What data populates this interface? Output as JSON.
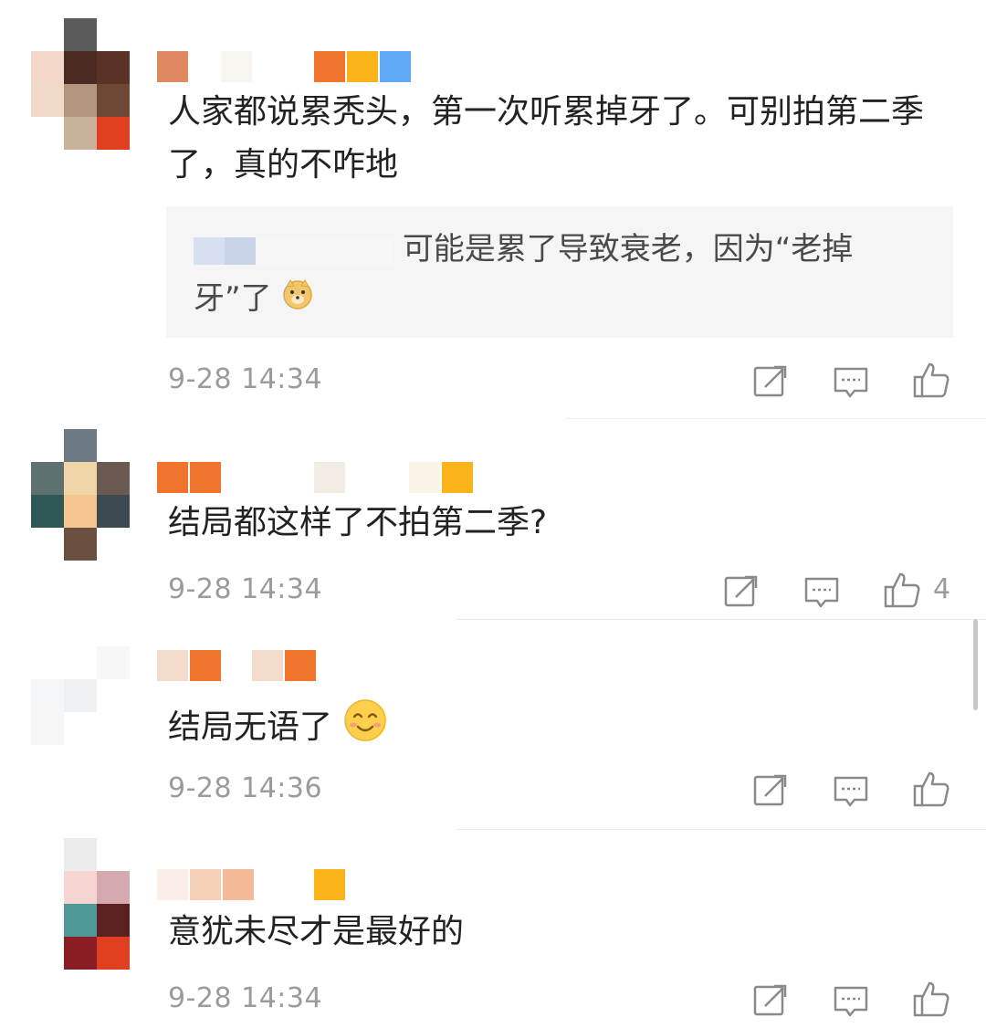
{
  "comments": [
    {
      "text": "人家都说累秃头，第一次听累掉牙了。可别拍第二季了，真的不咋地",
      "reply": {
        "text": "可能是累了导致衰老，因为“老掉牙”了",
        "emoji_icon": "doge-emoji-icon"
      },
      "time": "9-28 14:34",
      "like_count": ""
    },
    {
      "text": "结局都这样了不拍第二季?",
      "time": "9-28 14:34",
      "like_count": "4"
    },
    {
      "text": "结局无语了",
      "emoji_icon": "smile-emoji-icon",
      "time": "9-28 14:36",
      "like_count": ""
    },
    {
      "text": "意犹未尽才是最好的",
      "time": "9-28 14:34",
      "like_count": ""
    }
  ],
  "icons": {
    "repost": "repost-icon",
    "comment": "comment-icon",
    "like": "like-icon"
  },
  "colors": {
    "text": "#222222",
    "meta": "#9b9b9b",
    "quote_bg": "#f5f5f5",
    "badge_orange": "#f0742b",
    "badge_yellow": "#fbb31a",
    "badge_blue": "#5ea8f5"
  }
}
